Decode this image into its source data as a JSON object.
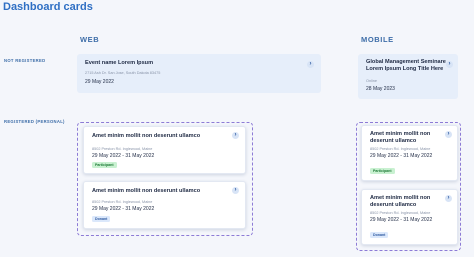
{
  "page_title": "Dashboard cards",
  "columns": {
    "web": "WEB",
    "mobile": "MOBILE"
  },
  "rows": {
    "not_registered": "NOT REGISTERED",
    "registered": "REGISTERED (PERSONAL)"
  },
  "web_not_registered": {
    "title": "Event name Lorem Ipsum",
    "address": "2715 Ash Dr. San Jose, South Dakota 83475",
    "date": "29 May 2022"
  },
  "mobile_not_registered": {
    "title": "Global Management Seminare Lorem Ipsum Long Title Here",
    "address": "Online",
    "date": "28 May 2023"
  },
  "web_registered": [
    {
      "title": "Amet minim mollit non deserunt ullamco",
      "address": "8502 Preston Rd. Inglewood, Maine",
      "date": "29 May 2022 - 31 May 2022",
      "badge": "Participant"
    },
    {
      "title": "Amet minim mollit non deserunt ullamco",
      "address": "8502 Preston Rd. Inglewood, Maine",
      "date": "29 May 2022 - 31 May 2022",
      "badge": "Donant"
    }
  ],
  "mobile_registered": [
    {
      "title": "Amet minim mollit non deserunt ullamco",
      "address": "8502 Preston Rd. Inglewood, Maine",
      "date": "29 May 2022 - 31 May 2022",
      "badge": "Participant"
    },
    {
      "title": "Amet minim mollit non deserunt ullamco",
      "address": "8502 Preston Rd. Inglewood, Maine",
      "date": "29 May 2022 - 31 May 2022",
      "badge": "Donant"
    }
  ],
  "icons": {
    "chevron": "chevron-right-icon"
  },
  "colors": {
    "accent": "#2f6fc4",
    "dashed_border": "#8d7bd6",
    "participant_badge": "#c9f1d1",
    "donant_badge": "#dbe8fb"
  }
}
